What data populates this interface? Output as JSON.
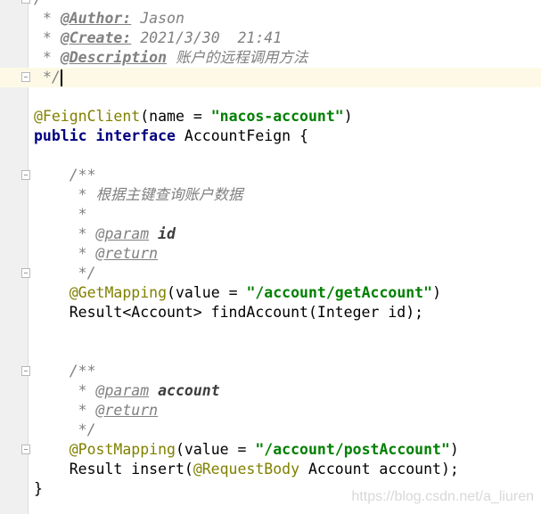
{
  "editor": {
    "current_line": 4,
    "fold_lines": [
      0,
      4,
      9,
      14,
      19,
      23
    ],
    "lines": [
      [
        {
          "t": "/",
          "k": "c"
        }
      ],
      [
        {
          "t": " * ",
          "k": "c"
        },
        {
          "t": "@Author:",
          "k": "tag"
        },
        {
          "t": " Jason",
          "k": "c"
        }
      ],
      [
        {
          "t": " * ",
          "k": "c"
        },
        {
          "t": "@Create:",
          "k": "tag"
        },
        {
          "t": " 2021/3/30  21:41",
          "k": "c"
        }
      ],
      [
        {
          "t": " * ",
          "k": "c"
        },
        {
          "t": "@Description",
          "k": "tag"
        },
        {
          "t": " 账户的远程调用方法",
          "k": "c"
        }
      ],
      [
        {
          "t": " */",
          "k": "c"
        }
      ],
      [],
      [
        {
          "t": "@FeignClient",
          "k": "ann"
        },
        {
          "t": "(name = ",
          "k": "p"
        },
        {
          "t": "\"nacos-account\"",
          "k": "str"
        },
        {
          "t": ")",
          "k": "p"
        }
      ],
      [
        {
          "t": "public",
          "k": "kw"
        },
        {
          "t": " ",
          "k": "p"
        },
        {
          "t": "interface",
          "k": "kw"
        },
        {
          "t": " AccountFeign {",
          "k": "p"
        }
      ],
      [],
      [
        {
          "t": "    /**",
          "k": "c"
        }
      ],
      [
        {
          "t": "     * 根据主键查询账户数据",
          "k": "c"
        }
      ],
      [
        {
          "t": "     *",
          "k": "c"
        }
      ],
      [
        {
          "t": "     * ",
          "k": "c"
        },
        {
          "t": "@param",
          "k": "tagv"
        },
        {
          "t": " ",
          "k": "c"
        },
        {
          "t": "id",
          "k": "pn"
        }
      ],
      [
        {
          "t": "     * ",
          "k": "c"
        },
        {
          "t": "@return",
          "k": "tagv"
        }
      ],
      [
        {
          "t": "     */",
          "k": "c"
        }
      ],
      [
        {
          "t": "    ",
          "k": "p"
        },
        {
          "t": "@GetMapping",
          "k": "ann"
        },
        {
          "t": "(value = ",
          "k": "p"
        },
        {
          "t": "\"/account/getAccount\"",
          "k": "str"
        },
        {
          "t": ")",
          "k": "p"
        }
      ],
      [
        {
          "t": "    Result<Account> findAccount(Integer id);",
          "k": "p"
        }
      ],
      [],
      [],
      [
        {
          "t": "    /**",
          "k": "c"
        }
      ],
      [
        {
          "t": "     * ",
          "k": "c"
        },
        {
          "t": "@param",
          "k": "tagv"
        },
        {
          "t": " ",
          "k": "c"
        },
        {
          "t": "account",
          "k": "pn"
        }
      ],
      [
        {
          "t": "     * ",
          "k": "c"
        },
        {
          "t": "@return",
          "k": "tagv"
        }
      ],
      [
        {
          "t": "     */",
          "k": "c"
        }
      ],
      [
        {
          "t": "    ",
          "k": "p"
        },
        {
          "t": "@PostMapping",
          "k": "ann"
        },
        {
          "t": "(value = ",
          "k": "p"
        },
        {
          "t": "\"/account/postAccount\"",
          "k": "str"
        },
        {
          "t": ")",
          "k": "p"
        }
      ],
      [
        {
          "t": "    Result insert(",
          "k": "p"
        },
        {
          "t": "@RequestBody",
          "k": "ann"
        },
        {
          "t": " Account account);",
          "k": "p"
        }
      ],
      [
        {
          "t": "}",
          "k": "p"
        }
      ]
    ]
  },
  "watermark": "https://blog.csdn.net/a_liuren"
}
